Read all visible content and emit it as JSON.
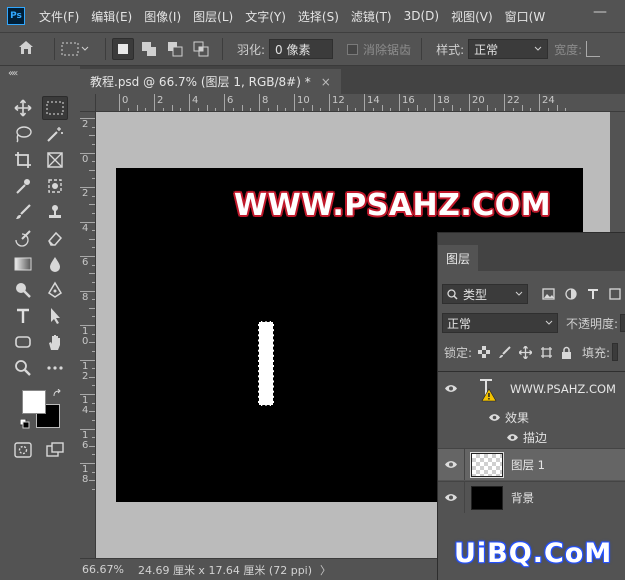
{
  "app": {
    "logo": "Ps"
  },
  "menubar": {
    "items": [
      "文件(F)",
      "编辑(E)",
      "图像(I)",
      "图层(L)",
      "文字(Y)",
      "选择(S)",
      "滤镜(T)",
      "3D(D)",
      "视图(V)",
      "窗口(W"
    ],
    "minimize_glyph": "—"
  },
  "options": {
    "feather_label": "羽化:",
    "feather_value": "0 像素",
    "antialias_label": "消除锯齿",
    "style_label": "样式:",
    "style_value": "正常",
    "width_label": "宽度:"
  },
  "toolbox": {
    "collapse_glyph": "««"
  },
  "document": {
    "tab_title": "教程.psd @ 66.7% (图层 1, RGB/8#) *",
    "close_glyph": "×",
    "canvas_text": "WWW.PSAHZ.COM",
    "ruler_h_labels": [
      "0",
      "2",
      "4",
      "6",
      "8",
      "10",
      "12",
      "14",
      "16",
      "18",
      "20",
      "22",
      "24"
    ],
    "ruler_v_labels": [
      "2",
      "0",
      "2",
      "4",
      "6",
      "8",
      "1\n0",
      "1\n2",
      "1\n4",
      "1\n6",
      "1\n8"
    ]
  },
  "status": {
    "zoom": "66.67%",
    "doc_size": "24.69 厘米 x 17.64 厘米 (72 ppi)",
    "arrow": "〉"
  },
  "layers_panel": {
    "tab_label": "图层",
    "filter_label": "类型",
    "blend_mode": "正常",
    "opacity_label": "不透明度:",
    "lock_label": "锁定:",
    "fill_label": "填充:",
    "layers": [
      {
        "name": "WWW.PSAHZ.COM",
        "kind": "text"
      },
      {
        "name": "图层 1",
        "kind": "pixel"
      },
      {
        "name": "背景",
        "kind": "background"
      }
    ],
    "effects_label": "效果",
    "stroke_label": "描边"
  },
  "watermark": "UiBQ.CoM",
  "colors": {
    "ui_bg": "#535353",
    "panel_dark": "#434343",
    "accent_blue": "#31a8ff",
    "text_stroke_red": "#c0192b"
  }
}
